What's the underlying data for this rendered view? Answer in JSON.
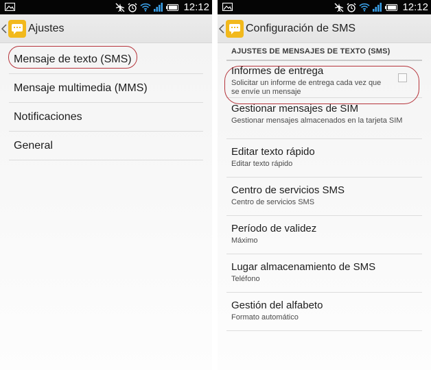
{
  "status_bar": {
    "time": "12:12",
    "icons": [
      "gallery-icon",
      "airplane-mode-icon",
      "alarm-icon",
      "wifi-icon",
      "signal-icon",
      "battery-icon"
    ]
  },
  "left_screen": {
    "title": "Ajustes",
    "items": [
      {
        "label": "Mensaje de texto (SMS)"
      },
      {
        "label": "Mensaje multimedia (MMS)"
      },
      {
        "label": "Notificaciones"
      },
      {
        "label": "General"
      }
    ]
  },
  "right_screen": {
    "title": "Configuración de SMS",
    "section_header": "AJUSTES DE MENSAJES DE TEXTO (SMS)",
    "items": [
      {
        "title": "Informes de entrega",
        "summary": "Solicitar un informe de entrega cada vez que se envíe un mensaje",
        "checked": false
      },
      {
        "title": "Gestionar mensajes de SIM",
        "summary": "Gestionar mensajes almacenados en la tarjeta SIM"
      },
      {
        "title": "Editar texto rápido",
        "summary": "Editar texto rápido"
      },
      {
        "title": "Centro de servicios SMS",
        "summary": "Centro de servicios SMS"
      },
      {
        "title": "Período de validez",
        "summary": "Máximo"
      },
      {
        "title": "Lugar almacenamiento de SMS",
        "summary": "Teléfono"
      },
      {
        "title": "Gestión del alfabeto",
        "summary": "Formato automático"
      }
    ]
  },
  "colors": {
    "status_bar": "#050505",
    "app_icon": "#f2b91c",
    "highlight": "#b5333a"
  }
}
